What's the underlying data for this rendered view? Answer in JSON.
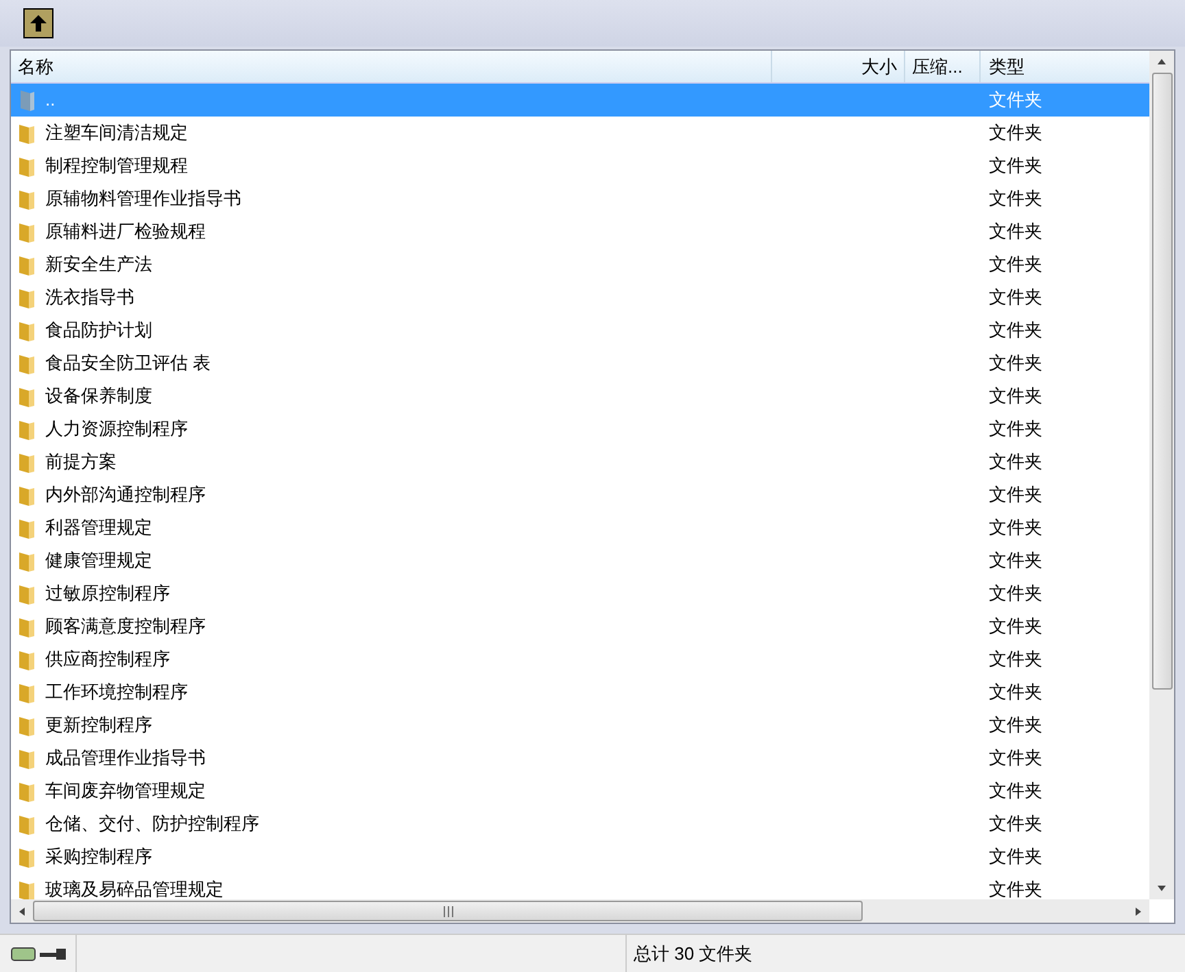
{
  "columns": [
    {
      "label": "名称"
    },
    {
      "label": "大小"
    },
    {
      "label": "压缩..."
    },
    {
      "label": "类型"
    }
  ],
  "rows": [
    {
      "name": "..",
      "type": "文件夹",
      "kind": "parent",
      "selected": true
    },
    {
      "name": "注塑车间清洁规定",
      "type": "文件夹",
      "kind": "folder",
      "selected": false
    },
    {
      "name": "制程控制管理规程",
      "type": "文件夹",
      "kind": "folder",
      "selected": false
    },
    {
      "name": "原辅物料管理作业指导书",
      "type": "文件夹",
      "kind": "folder",
      "selected": false
    },
    {
      "name": "原辅料进厂检验规程",
      "type": "文件夹",
      "kind": "folder",
      "selected": false
    },
    {
      "name": "新安全生产法",
      "type": "文件夹",
      "kind": "folder",
      "selected": false
    },
    {
      "name": "洗衣指导书",
      "type": "文件夹",
      "kind": "folder",
      "selected": false
    },
    {
      "name": "食品防护计划",
      "type": "文件夹",
      "kind": "folder",
      "selected": false
    },
    {
      "name": "食品安全防卫评估 表",
      "type": "文件夹",
      "kind": "folder",
      "selected": false
    },
    {
      "name": "设备保养制度",
      "type": "文件夹",
      "kind": "folder",
      "selected": false
    },
    {
      "name": "人力资源控制程序",
      "type": "文件夹",
      "kind": "folder",
      "selected": false
    },
    {
      "name": "前提方案",
      "type": "文件夹",
      "kind": "folder",
      "selected": false
    },
    {
      "name": "内外部沟通控制程序",
      "type": "文件夹",
      "kind": "folder",
      "selected": false
    },
    {
      "name": "利器管理规定",
      "type": "文件夹",
      "kind": "folder",
      "selected": false
    },
    {
      "name": "健康管理规定",
      "type": "文件夹",
      "kind": "folder",
      "selected": false
    },
    {
      "name": "过敏原控制程序",
      "type": "文件夹",
      "kind": "folder",
      "selected": false
    },
    {
      "name": "顾客满意度控制程序",
      "type": "文件夹",
      "kind": "folder",
      "selected": false
    },
    {
      "name": "供应商控制程序",
      "type": "文件夹",
      "kind": "folder",
      "selected": false
    },
    {
      "name": "工作环境控制程序",
      "type": "文件夹",
      "kind": "folder",
      "selected": false
    },
    {
      "name": "更新控制程序",
      "type": "文件夹",
      "kind": "folder",
      "selected": false
    },
    {
      "name": "成品管理作业指导书",
      "type": "文件夹",
      "kind": "folder",
      "selected": false
    },
    {
      "name": "车间废弃物管理规定",
      "type": "文件夹",
      "kind": "folder",
      "selected": false
    },
    {
      "name": "仓储、交付、防护控制程序",
      "type": "文件夹",
      "kind": "folder",
      "selected": false
    },
    {
      "name": "采购控制程序",
      "type": "文件夹",
      "kind": "folder",
      "selected": false
    },
    {
      "name": "玻璃及易碎品管理规定",
      "type": "文件夹",
      "kind": "folder",
      "selected": false
    }
  ],
  "status_bar": {
    "summary": "总计 30 文件夹"
  }
}
